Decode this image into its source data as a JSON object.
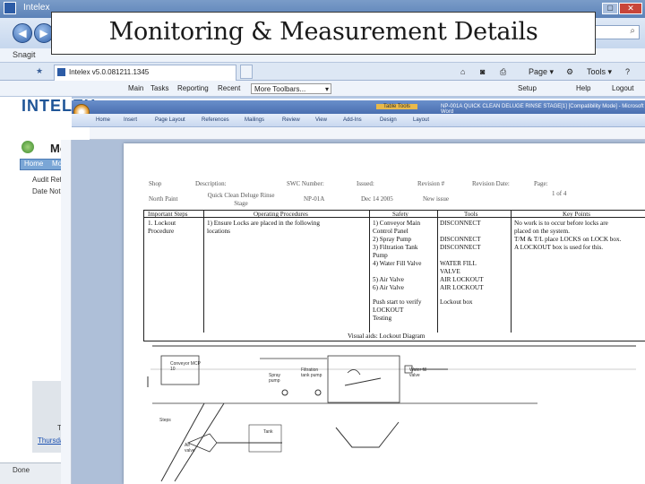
{
  "slide": {
    "title": "Monitoring & Measurement Details"
  },
  "ie": {
    "window_title_prefix": "Intelex",
    "snagit_label": "Snagit",
    "tab_label": "Intelex v5.0.081211.1345",
    "toolbar_page": "Page",
    "toolbar_tools": "Tools",
    "menu": [
      "Main",
      "Tasks",
      "Reporting",
      "Recent",
      "More Toolbars..."
    ],
    "menu_right": [
      "Setup",
      "Help",
      "Logout"
    ],
    "status": "Done"
  },
  "portal": {
    "logo": "INTELEX",
    "heading": "Mo",
    "tabs": [
      "Home",
      "Mon"
    ],
    "fields": [
      "Audit Ref",
      "Date Not"
    ],
    "thumb_prefix": "Th",
    "link_text": "Thursday"
  },
  "word": {
    "contextual_tab": "Table Tools",
    "doc_title": "NP-001A QUICK CLEAN DELUGE RINSE STAGE[1] [Compatibility Mode] - Microsoft Word",
    "ribbon_tabs": [
      "Home",
      "Insert",
      "Page Layout",
      "References",
      "Mailings",
      "Review",
      "View",
      "Add-Ins",
      "Design",
      "Layout"
    ]
  },
  "doc": {
    "header_labels": [
      "Shop",
      "Description:",
      "SWC Number:",
      "Issued:",
      "Revision #",
      "Revision Date:",
      "Page:"
    ],
    "header_values": [
      "North Paint",
      "Quick Clean Deluge Rinse Stage",
      "NP-01A",
      "Dec 14 2005",
      "New issue",
      "",
      "1 of 4"
    ],
    "columns": [
      "Important Steps",
      "Operating Procedures",
      "Safety",
      "Tools",
      "Key Points"
    ],
    "step": [
      "1. Lockout",
      "Procedure"
    ],
    "procedure": [
      "1) Ensure Locks are placed in the following",
      "locations"
    ],
    "safety_items": [
      "1) Conveyor Main",
      "Control Panel",
      "2) Spray Pump",
      "3) Filtration Tank",
      "Pump",
      "4) Water Fill Valve",
      "",
      "5) Air Valve",
      "6) Air Valve",
      "",
      "Push start to verify",
      "LOCKOUT",
      "Testing"
    ],
    "tools_items": [
      "DISCONNECT",
      "",
      "DISCONNECT",
      "DISCONNECT",
      "",
      "WATER FILL",
      "VALVE",
      "AIR LOCKOUT",
      "AIR LOCKOUT",
      "",
      "Lockout box"
    ],
    "key_points": [
      "No work is to occur before locks are",
      "placed on the system.",
      "T/M & T/L place LOCKS on LOCK box.",
      "A LOCKOUT box is used for this."
    ],
    "diagram_caption": "Visual aids: Lockout Diagram",
    "diagram_labels": {
      "conveyor": "Conveyor MCP 10",
      "spray": "Spray pump",
      "filtration": "Filtration tank pump",
      "water": "Water fill valve",
      "steps": "Steps",
      "tank": "Tank",
      "air": "Air valve"
    }
  },
  "colors": {
    "accent": "#1f5597",
    "ribbon": "#4a6fb0"
  }
}
